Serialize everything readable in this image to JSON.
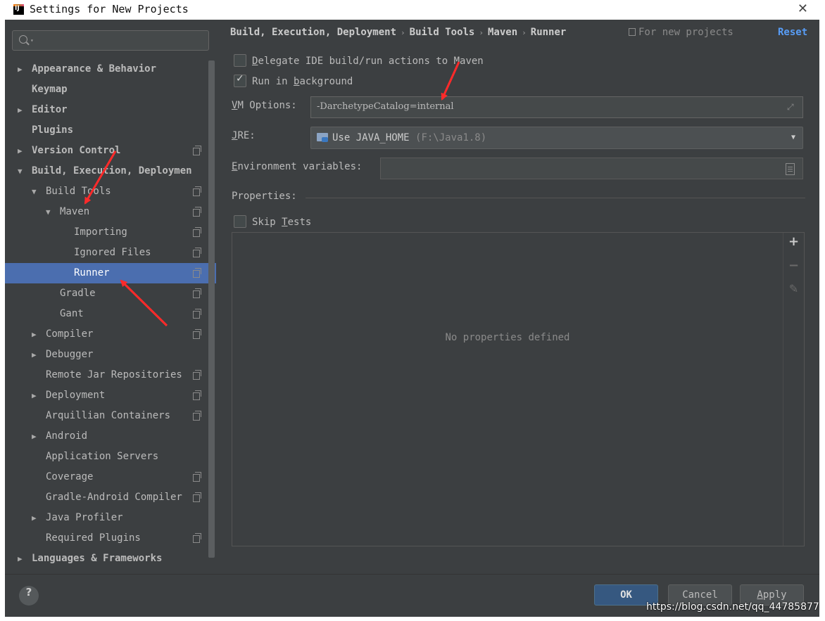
{
  "window": {
    "title": "Settings for New Projects",
    "close_glyph": "✕"
  },
  "search": {
    "placeholder": ""
  },
  "tree": [
    {
      "label": "Appearance & Behavior",
      "arrow": "▶",
      "bold": true
    },
    {
      "label": "Keymap",
      "arrow": "",
      "bold": true
    },
    {
      "label": "Editor",
      "arrow": "▶",
      "bold": true
    },
    {
      "label": "Plugins",
      "arrow": "",
      "bold": true
    },
    {
      "label": "Version Control",
      "arrow": "▶",
      "bold": true,
      "copy_icon": true
    },
    {
      "label": "Build, Execution, Deploymen",
      "arrow": "▼",
      "bold": true
    },
    {
      "label": "Build Tools",
      "arrow": "▼",
      "copy_icon": true
    },
    {
      "label": "Maven",
      "arrow": "▼",
      "copy_icon": true
    },
    {
      "label": "Importing",
      "arrow": "",
      "copy_icon": true
    },
    {
      "label": "Ignored Files",
      "arrow": "",
      "copy_icon": true
    },
    {
      "label": "Runner",
      "arrow": "",
      "copy_icon": true,
      "selected": true
    },
    {
      "label": "Gradle",
      "arrow": "",
      "copy_icon": true
    },
    {
      "label": "Gant",
      "arrow": "",
      "copy_icon": true
    },
    {
      "label": "Compiler",
      "arrow": "▶",
      "copy_icon": true
    },
    {
      "label": "Debugger",
      "arrow": "▶"
    },
    {
      "label": "Remote Jar Repositories",
      "arrow": "",
      "copy_icon": true
    },
    {
      "label": "Deployment",
      "arrow": "▶",
      "copy_icon": true
    },
    {
      "label": "Arquillian Containers",
      "arrow": "",
      "copy_icon": true
    },
    {
      "label": "Android",
      "arrow": "▶"
    },
    {
      "label": "Application Servers",
      "arrow": ""
    },
    {
      "label": "Coverage",
      "arrow": "",
      "copy_icon": true
    },
    {
      "label": "Gradle-Android Compiler",
      "arrow": "",
      "copy_icon": true
    },
    {
      "label": "Java Profiler",
      "arrow": "▶"
    },
    {
      "label": "Required Plugins",
      "arrow": "",
      "copy_icon": true
    },
    {
      "label": "Languages & Frameworks",
      "arrow": "▶",
      "bold": true
    }
  ],
  "breadcrumb": [
    "Build, Execution, Deployment",
    "Build Tools",
    "Maven",
    "Runner"
  ],
  "breadcrumb_sep": "›",
  "scope_note": "For new projects",
  "reset_label": "Reset",
  "delegate": {
    "first": "D",
    "rest": "elegate IDE build/run actions to Maven",
    "checked": false
  },
  "background": {
    "pre": "Run in ",
    "ul": "b",
    "post": "ackground",
    "checked": true
  },
  "vm_options": {
    "label_ul": "V",
    "label_rest": "M Options:",
    "value": "-DarchetypeCatalog=internal",
    "expand_glyph": "⤢"
  },
  "jre": {
    "label_ul": "J",
    "label_rest": "RE:",
    "value": "Use JAVA_HOME",
    "hint": "(F:\\Java1.8)",
    "drop_glyph": "▼"
  },
  "env": {
    "label_ul": "E",
    "label_rest": "nvironment variables:",
    "value": ""
  },
  "properties": {
    "label": "Properties:",
    "empty_text": "No properties defined",
    "add_glyph": "+",
    "remove_glyph": "−",
    "edit_glyph": "✎"
  },
  "skip_tests": {
    "pre": "Skip ",
    "ul": "T",
    "post": "ests",
    "checked": false
  },
  "buttons": {
    "help": "?",
    "ok": "OK",
    "cancel": "Cancel",
    "apply_ul": "A",
    "apply_rest": "pply"
  },
  "watermark": "https://blog.csdn.net/qq_44785877",
  "colors": {
    "accent": "#4b6eaf",
    "link": "#589df6",
    "annotation": "#ff2a2a",
    "ok_button": "#365880"
  }
}
